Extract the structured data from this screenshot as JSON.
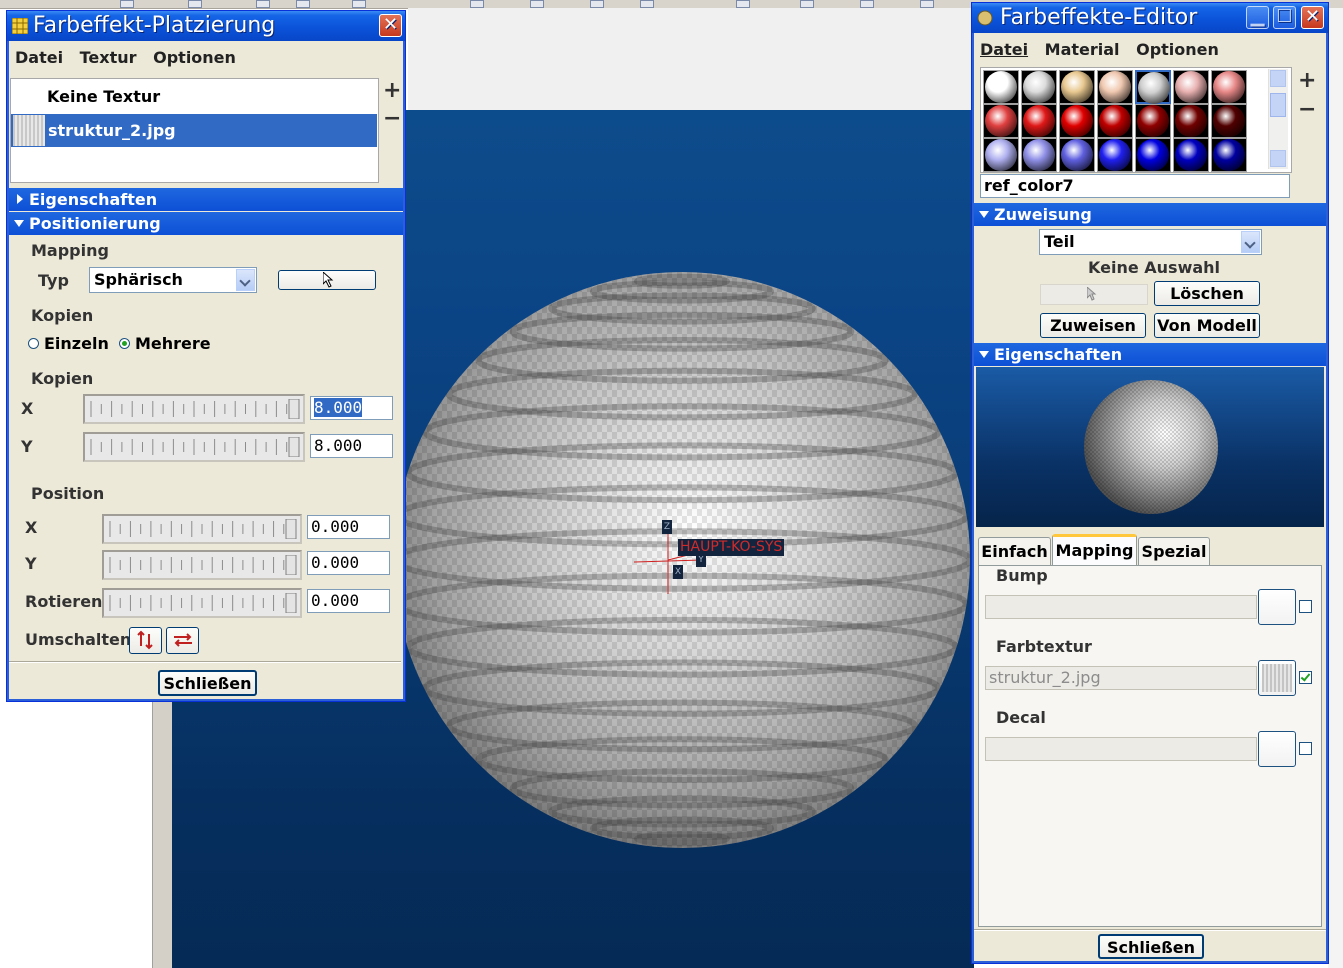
{
  "placement_window": {
    "title": "Farbeffekt-Platzierung",
    "menu": [
      "Datei",
      "Textur",
      "Optionen"
    ],
    "textures": [
      {
        "label": "Keine Textur"
      },
      {
        "label": "struktur_2.jpg"
      }
    ],
    "add_symbol": "+",
    "remove_symbol": "−",
    "eigenschaften_header": "Eigenschaften",
    "positionierung_header": "Positionierung",
    "mapping_label": "Mapping",
    "typ_label": "Typ",
    "typ_value": "Sphärisch",
    "kopien_label": "Kopien",
    "einzeln_label": "Einzeln",
    "mehrere_label": "Mehrere",
    "kopien_section_label": "Kopien",
    "x_label": "X",
    "y_label": "Y",
    "kopien_x": "8.000",
    "kopien_y": "8.000",
    "position_label": "Position",
    "pos_x_label": "X",
    "pos_y_label": "Y",
    "rotieren_label": "Rotieren",
    "pos_x": "0.000",
    "pos_y": "0.000",
    "rotieren": "0.000",
    "umschalten_label": "Umschalten",
    "close_label": "Schließen"
  },
  "viewport": {
    "cs_label": "HAUPT-KO-SYS",
    "axis_z": "Z",
    "axis_x": "X",
    "axis_y": "Y"
  },
  "editor_window": {
    "title": "Farbeffekte-Editor",
    "menu": [
      "Datei",
      "Material",
      "Optionen"
    ],
    "name_field": "ref_color7",
    "add_symbol": "+",
    "remove_symbol": "−",
    "zuweisung_header": "Zuweisung",
    "zuweisung_select": "Teil",
    "keine_auswahl": "Keine Auswahl",
    "loeschen_label": "Löschen",
    "zuweisen_label": "Zuweisen",
    "von_modell_label": "Von Modell",
    "eigenschaften_header": "Eigenschaften",
    "tabs": [
      "Einfach",
      "Mapping",
      "Spezial"
    ],
    "active_tab": "Mapping",
    "bump_label": "Bump",
    "farbtextur_label": "Farbtextur",
    "farbtextur_value": "struktur_2.jpg",
    "decal_label": "Decal",
    "close_label": "Schließen",
    "swatch_colors": [
      [
        "#ffffff",
        "#dcdcdc",
        "#e8c890",
        "#f0c8b0",
        "#cfcfcf",
        "#e8b0b0",
        "#e88888"
      ],
      [
        "#e04040",
        "#e01818",
        "#e00000",
        "#c00000",
        "#900000",
        "#700000",
        "#500000"
      ],
      [
        "#b0b0f0",
        "#9090e8",
        "#6060e0",
        "#2020f0",
        "#0000e0",
        "#0000c0",
        "#0000a0"
      ]
    ]
  }
}
